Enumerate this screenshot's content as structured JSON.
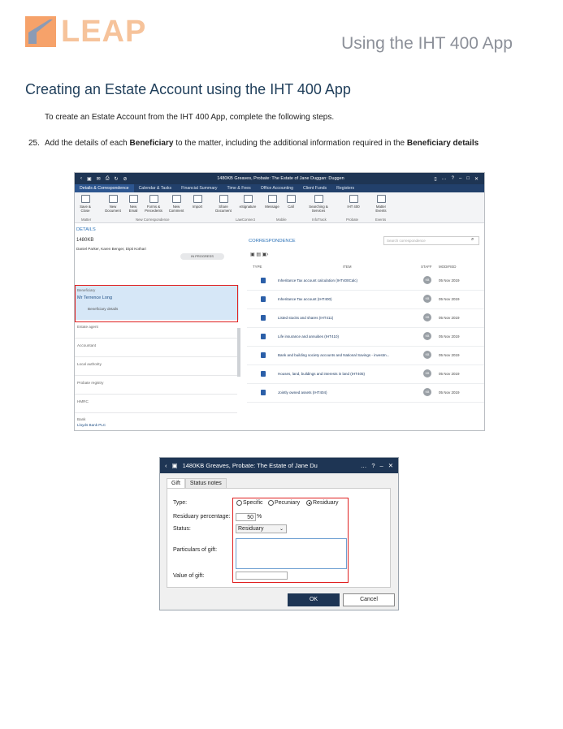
{
  "header": {
    "logo_text": "LEAP",
    "doc_title": "Using the IHT 400 App"
  },
  "heading": "Creating an Estate Account using the IHT 400 App",
  "intro": "To create an Estate Account from the IHT 400 App, complete the following steps.",
  "step": {
    "number": "25.",
    "text_pre": "Add the details of each ",
    "bold1": "Beneficiary",
    "text_mid": " to the matter, including the additional information required in the ",
    "bold2": "Beneficiary details"
  },
  "app": {
    "title": "1480KB Greaves, Probate: The Estate of Jane Duggan: Duggen",
    "menu": [
      "Details & Correspondence",
      "Calendar & Tasks",
      "Financial Summary",
      "Time & Fees",
      "Office Accounting",
      "Client Funds",
      "Registers"
    ],
    "ribbon": [
      {
        "label": "Save & Close",
        "group": "Matter"
      },
      {
        "label": "New Document",
        "group": ""
      },
      {
        "label": "New Email",
        "group": ""
      },
      {
        "label": "Forms & Precedents",
        "group": "New Correspondence"
      },
      {
        "label": "New Comment",
        "group": ""
      },
      {
        "label": "Import",
        "group": ""
      },
      {
        "label": "Share Document",
        "group": ""
      },
      {
        "label": "eSignature",
        "group": "LawConnect"
      },
      {
        "label": "Message",
        "group": ""
      },
      {
        "label": "Call",
        "group": "Mobile"
      },
      {
        "label": "Searching & Services",
        "group": "InfoTrack"
      },
      {
        "label": "IHT 400",
        "group": "Probate"
      },
      {
        "label": "Matter Events",
        "group": "Events"
      }
    ],
    "details": {
      "heading": "DETAILS",
      "matter": "1480KB",
      "staff": "Daniel Parker, Karen Benger, Dipti Kothari",
      "status": "IN PROGRESS",
      "beneficiary_label": "Beneficiary",
      "beneficiary_name": "Mr Terrence Long",
      "beneficiary_details": "Beneficiary details",
      "rows": [
        "Estate agent",
        "Accountant",
        "Local authority",
        "Probate registry",
        "HMRC",
        "Bank"
      ],
      "bank_value": "Lloyds Bank PLC"
    },
    "correspondence": {
      "heading": "CORRESPONDENCE",
      "search_placeholder": "Search correspondence",
      "col_type": "TYPE",
      "col_item": "ITEM",
      "col_staff": "STAFF",
      "col_modified": "MODIFIED",
      "items": [
        {
          "item": "Inheritance Tax account calculation (IHT400Calc)",
          "staff": "KB",
          "date": "05 Nov 2019"
        },
        {
          "item": "Inheritance Tax account (IHT400)",
          "staff": "KB",
          "date": "05 Nov 2019"
        },
        {
          "item": "Listed stocks and shares (IHT411)",
          "staff": "KB",
          "date": "05 Nov 2019"
        },
        {
          "item": "Life insurance and annuities (IHT410)",
          "staff": "KB",
          "date": "05 Nov 2019"
        },
        {
          "item": "Bank and building society accounts and National Savings - investm...",
          "staff": "KB",
          "date": "05 Nov 2019"
        },
        {
          "item": "Houses, land, buildings and interests in land (IHT405)",
          "staff": "KB",
          "date": "05 Nov 2019"
        },
        {
          "item": "Jointly owned assets (IHT404)",
          "staff": "KB",
          "date": "05 Nov 2019"
        }
      ]
    }
  },
  "dialog": {
    "title": "1480KB Greaves, Probate: The Estate of Jane Du",
    "tabs": [
      "Gift",
      "Status notes"
    ],
    "type_label": "Type:",
    "type_options": [
      "Specific",
      "Pecuniary",
      "Residuary"
    ],
    "type_selected": "Residuary",
    "residuary_label": "Residuary percentage:",
    "residuary_value": "50",
    "residuary_unit": "%",
    "status_label": "Status:",
    "status_value": "Residuary",
    "particulars_label": "Particulars of gift:",
    "value_label": "Value of gift:",
    "ok": "OK",
    "cancel": "Cancel"
  }
}
